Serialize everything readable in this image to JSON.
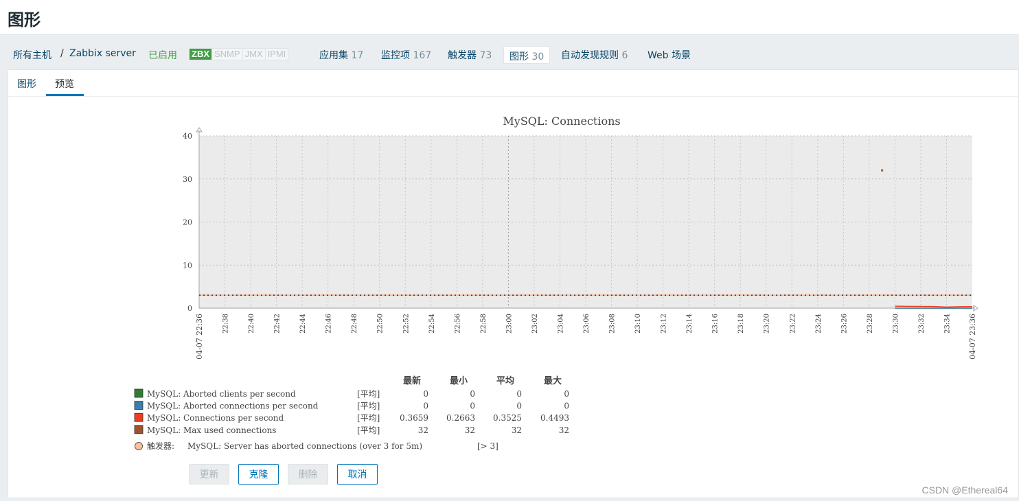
{
  "page": {
    "title": "图形"
  },
  "breadcrumb": {
    "all_hosts": "所有主机",
    "separator": "/",
    "host": "Zabbix server",
    "enabled": "已启用"
  },
  "status_tags": [
    "ZBX",
    "SNMP",
    "JMX",
    "IPMI"
  ],
  "nav": {
    "applications": {
      "label": "应用集",
      "count": "17"
    },
    "items": {
      "label": "监控项",
      "count": "167"
    },
    "triggers": {
      "label": "触发器",
      "count": "73"
    },
    "graphs": {
      "label": "图形",
      "count": "30"
    },
    "discovery": {
      "label": "自动发现规则",
      "count": "6"
    },
    "web": {
      "label": "Web 场景"
    }
  },
  "subtabs": {
    "graph": "图形",
    "preview": "预览"
  },
  "buttons": {
    "update": "更新",
    "clone": "克隆",
    "delete": "删除",
    "cancel": "取消"
  },
  "watermark": "CSDN @Ethereal64",
  "colors": {
    "aborted_clients": "#2e7d32",
    "aborted_connections": "#3b7fad",
    "connections": "#f03c1e",
    "max_used": "#a0522d",
    "trigger": "#ffbe9a"
  },
  "chart_data": {
    "type": "line",
    "title": "MySQL: Connections",
    "ylim": [
      0,
      40
    ],
    "y_ticks": [
      "0",
      "10",
      "20",
      "30",
      "40"
    ],
    "x_start_label": "04-07 22:36",
    "x_end_label": "04-07 23:36",
    "x_ticks": [
      "22:38",
      "22:40",
      "22:42",
      "22:44",
      "22:46",
      "22:48",
      "22:50",
      "22:52",
      "22:54",
      "22:56",
      "22:58",
      "23:00",
      "23:02",
      "23:04",
      "23:06",
      "23:08",
      "23:10",
      "23:12",
      "23:14",
      "23:16",
      "23:18",
      "23:20",
      "23:22",
      "23:24",
      "23:26",
      "23:28",
      "23:30",
      "23:32",
      "23:34"
    ],
    "grid": true,
    "trigger_threshold": 3,
    "series": [
      {
        "name": "MySQL: Aborted clients per second",
        "x": [
          "23:30",
          "23:36"
        ],
        "values": [
          0,
          0
        ]
      },
      {
        "name": "MySQL: Aborted connections per second",
        "x": [
          "23:30",
          "23:36"
        ],
        "values": [
          0,
          0
        ]
      },
      {
        "name": "MySQL: Connections per second",
        "x": [
          "23:30",
          "23:31",
          "23:32",
          "23:33",
          "23:34",
          "23:35",
          "23:36"
        ],
        "values": [
          0.4493,
          0.42,
          0.4,
          0.38,
          0.2663,
          0.34,
          0.3659
        ]
      },
      {
        "name": "MySQL: Max used connections",
        "x": [
          "23:29"
        ],
        "values": [
          32
        ]
      }
    ],
    "legend": {
      "headers": [
        "最新",
        "最小",
        "平均",
        "最大"
      ],
      "rows": [
        {
          "name": "MySQL: Aborted clients per second",
          "func": "[平均]",
          "last": "0",
          "min": "0",
          "avg": "0",
          "max": "0"
        },
        {
          "name": "MySQL: Aborted connections per second",
          "func": "[平均]",
          "last": "0",
          "min": "0",
          "avg": "0",
          "max": "0"
        },
        {
          "name": "MySQL: Connections per second",
          "func": "[平均]",
          "last": "0.3659",
          "min": "0.2663",
          "avg": "0.3525",
          "max": "0.4493"
        },
        {
          "name": "MySQL: Max used connections",
          "func": "[平均]",
          "last": "32",
          "min": "32",
          "avg": "32",
          "max": "32"
        }
      ],
      "trigger": {
        "prefix": "触发器:",
        "name": "MySQL: Server has aborted connections (over 3 for 5m)",
        "cond": "[> 3]"
      }
    }
  }
}
